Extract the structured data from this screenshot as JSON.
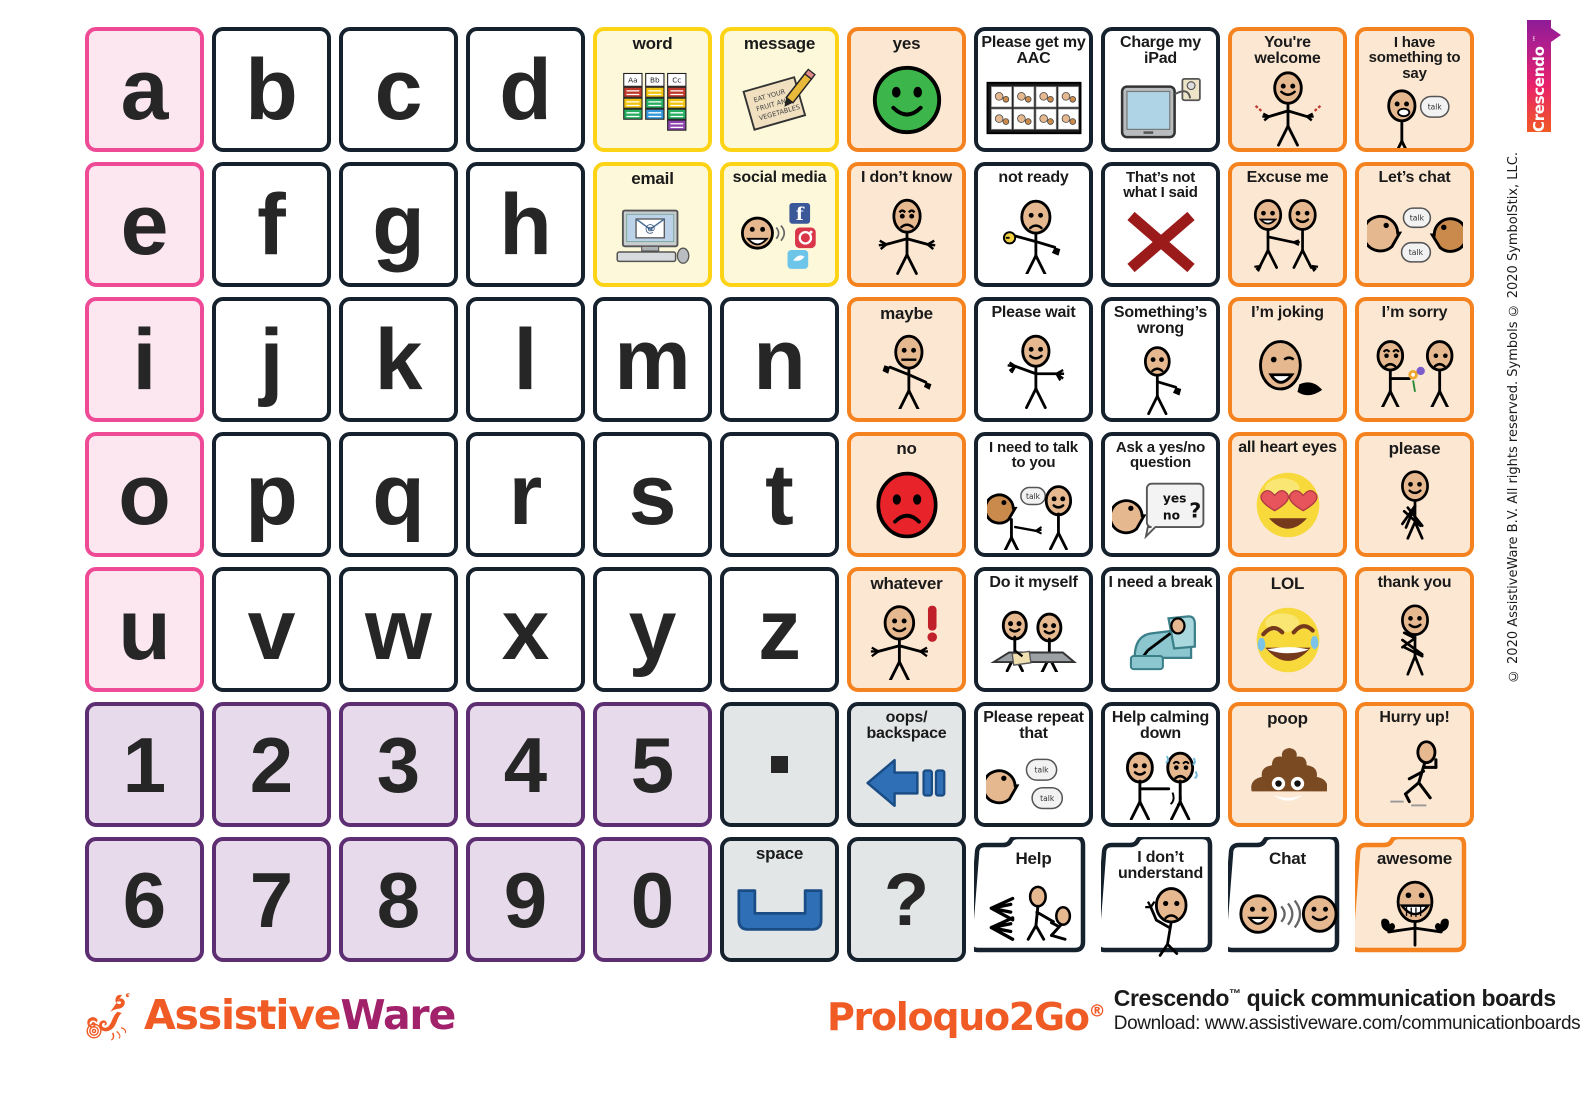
{
  "board": {
    "columns": 11,
    "rows": 7,
    "palette": {
      "vowel_fill": "#fce6f0",
      "vowel_border": "#ee4a96",
      "letter_fill": "#ffffff",
      "letter_border": "#16212e",
      "number_fill": "#e7daeb",
      "number_border": "#5d2e72",
      "key_fill": "#e3e6e6",
      "key_border": "#16212e",
      "cream_fill": "#fcf8d9",
      "cream_border": "#fdd316",
      "peach_fill": "#fce8d2",
      "peach_border": "#f4821f",
      "accent_orange": "#f05a24",
      "accent_purple": "#a2216b"
    },
    "cells": [
      {
        "r": 1,
        "c": 1,
        "kind": "vowel",
        "label": "a",
        "icon": "letter-a"
      },
      {
        "r": 1,
        "c": 2,
        "kind": "letter",
        "label": "b",
        "icon": "letter-b"
      },
      {
        "r": 1,
        "c": 3,
        "kind": "letter",
        "label": "c",
        "icon": "letter-c"
      },
      {
        "r": 1,
        "c": 4,
        "kind": "letter",
        "label": "d",
        "icon": "letter-d"
      },
      {
        "r": 1,
        "c": 5,
        "kind": "cream",
        "label": "word",
        "icon": "word-cards-icon"
      },
      {
        "r": 1,
        "c": 6,
        "kind": "cream",
        "label": "message",
        "icon": "note-and-pencil-icon"
      },
      {
        "r": 1,
        "c": 7,
        "kind": "peach",
        "label": "yes",
        "icon": "green-smiley-icon"
      },
      {
        "r": 1,
        "c": 8,
        "kind": "plain",
        "label": "Please get my AAC",
        "icon": "aac-device-grid-icon"
      },
      {
        "r": 1,
        "c": 9,
        "kind": "plain",
        "label": "Charge my iPad",
        "icon": "tablet-charging-icon"
      },
      {
        "r": 1,
        "c": 10,
        "kind": "peach",
        "label": "You're welcome",
        "icon": "person-shrug-welcome-icon"
      },
      {
        "r": 1,
        "c": 11,
        "kind": "peach",
        "label": "I have something to say",
        "icon": "person-talk-bubble-icon"
      },
      {
        "r": 2,
        "c": 1,
        "kind": "vowel",
        "label": "e",
        "icon": "letter-e"
      },
      {
        "r": 2,
        "c": 2,
        "kind": "letter",
        "label": "f",
        "icon": "letter-f"
      },
      {
        "r": 2,
        "c": 3,
        "kind": "letter",
        "label": "g",
        "icon": "letter-g"
      },
      {
        "r": 2,
        "c": 4,
        "kind": "letter",
        "label": "h",
        "icon": "letter-h"
      },
      {
        "r": 2,
        "c": 5,
        "kind": "cream",
        "label": "email",
        "icon": "computer-envelope-icon"
      },
      {
        "r": 2,
        "c": 6,
        "kind": "cream",
        "label": "social media",
        "icon": "social-media-icons"
      },
      {
        "r": 2,
        "c": 7,
        "kind": "peach",
        "label": "I don’t know",
        "icon": "person-unsure-icon"
      },
      {
        "r": 2,
        "c": 8,
        "kind": "plain",
        "label": "not ready",
        "icon": "person-thumbs-down-icon"
      },
      {
        "r": 2,
        "c": 9,
        "kind": "plain",
        "label": "That’s not what I said",
        "icon": "red-cross-icon"
      },
      {
        "r": 2,
        "c": 10,
        "kind": "peach",
        "label": "Excuse me",
        "icon": "two-people-passing-icon"
      },
      {
        "r": 2,
        "c": 11,
        "kind": "peach",
        "label": "Let’s chat",
        "icon": "two-faces-chatting-icon"
      },
      {
        "r": 3,
        "c": 1,
        "kind": "vowel",
        "label": "i",
        "icon": "letter-i"
      },
      {
        "r": 3,
        "c": 2,
        "kind": "letter",
        "label": "j",
        "icon": "letter-j"
      },
      {
        "r": 3,
        "c": 3,
        "kind": "letter",
        "label": "k",
        "icon": "letter-k"
      },
      {
        "r": 3,
        "c": 4,
        "kind": "letter",
        "label": "l",
        "icon": "letter-l"
      },
      {
        "r": 3,
        "c": 5,
        "kind": "letter",
        "label": "m",
        "icon": "letter-m"
      },
      {
        "r": 3,
        "c": 6,
        "kind": "letter",
        "label": "n",
        "icon": "letter-n"
      },
      {
        "r": 3,
        "c": 7,
        "kind": "peach",
        "label": "maybe",
        "icon": "person-hand-wobble-icon"
      },
      {
        "r": 3,
        "c": 8,
        "kind": "plain",
        "label": "Please wait",
        "icon": "person-hands-up-icon"
      },
      {
        "r": 3,
        "c": 9,
        "kind": "plain",
        "label": "Something’s wrong",
        "icon": "person-thumb-down-sad-icon"
      },
      {
        "r": 3,
        "c": 10,
        "kind": "peach",
        "label": "I’m joking",
        "icon": "person-winking-icon"
      },
      {
        "r": 3,
        "c": 11,
        "kind": "peach",
        "label": "I’m sorry",
        "icon": "person-offering-flower-icon"
      },
      {
        "r": 4,
        "c": 1,
        "kind": "vowel",
        "label": "o",
        "icon": "letter-o"
      },
      {
        "r": 4,
        "c": 2,
        "kind": "letter",
        "label": "p",
        "icon": "letter-p"
      },
      {
        "r": 4,
        "c": 3,
        "kind": "letter",
        "label": "q",
        "icon": "letter-q"
      },
      {
        "r": 4,
        "c": 4,
        "kind": "letter",
        "label": "r",
        "icon": "letter-r"
      },
      {
        "r": 4,
        "c": 5,
        "kind": "letter",
        "label": "s",
        "icon": "letter-s"
      },
      {
        "r": 4,
        "c": 6,
        "kind": "letter",
        "label": "t",
        "icon": "letter-t"
      },
      {
        "r": 4,
        "c": 7,
        "kind": "peach",
        "label": "no",
        "icon": "red-sad-face-icon"
      },
      {
        "r": 4,
        "c": 8,
        "kind": "plain",
        "label": "I need to talk to you",
        "icon": "two-people-talking-icon"
      },
      {
        "r": 4,
        "c": 9,
        "kind": "plain",
        "label": "Ask a yes/no question",
        "icon": "yes-no-question-bubble-icon"
      },
      {
        "r": 4,
        "c": 10,
        "kind": "peach",
        "label": "all heart eyes",
        "icon": "heart-eyes-emoji-icon"
      },
      {
        "r": 4,
        "c": 11,
        "kind": "peach",
        "label": "please",
        "icon": "person-please-icon"
      },
      {
        "r": 5,
        "c": 1,
        "kind": "vowel",
        "label": "u",
        "icon": "letter-u"
      },
      {
        "r": 5,
        "c": 2,
        "kind": "letter",
        "label": "v",
        "icon": "letter-v"
      },
      {
        "r": 5,
        "c": 3,
        "kind": "letter",
        "label": "w",
        "icon": "letter-w"
      },
      {
        "r": 5,
        "c": 4,
        "kind": "letter",
        "label": "x",
        "icon": "letter-x"
      },
      {
        "r": 5,
        "c": 5,
        "kind": "letter",
        "label": "y",
        "icon": "letter-y"
      },
      {
        "r": 5,
        "c": 6,
        "kind": "letter",
        "label": "z",
        "icon": "letter-z"
      },
      {
        "r": 5,
        "c": 7,
        "kind": "peach",
        "label": "whatever",
        "icon": "person-exclamation-icon"
      },
      {
        "r": 5,
        "c": 8,
        "kind": "plain",
        "label": "Do it myself",
        "icon": "person-writing-table-icon"
      },
      {
        "r": 5,
        "c": 9,
        "kind": "plain",
        "label": "I need a break",
        "icon": "person-in-recliner-icon"
      },
      {
        "r": 5,
        "c": 10,
        "kind": "peach",
        "label": "LOL",
        "icon": "laughing-tears-emoji-icon"
      },
      {
        "r": 5,
        "c": 11,
        "kind": "peach",
        "label": "thank you",
        "icon": "person-thank-you-icon"
      },
      {
        "r": 6,
        "c": 1,
        "kind": "num",
        "label": "1",
        "icon": "number-1"
      },
      {
        "r": 6,
        "c": 2,
        "kind": "num",
        "label": "2",
        "icon": "number-2"
      },
      {
        "r": 6,
        "c": 3,
        "kind": "num",
        "label": "3",
        "icon": "number-3"
      },
      {
        "r": 6,
        "c": 4,
        "kind": "num",
        "label": "4",
        "icon": "number-4"
      },
      {
        "r": 6,
        "c": 5,
        "kind": "num",
        "label": "5",
        "icon": "number-5"
      },
      {
        "r": 6,
        "c": 6,
        "kind": "key",
        "label": ".",
        "icon": "period-icon"
      },
      {
        "r": 6,
        "c": 7,
        "kind": "key",
        "label": "oops/ backspace",
        "icon": "backspace-arrow-icon"
      },
      {
        "r": 6,
        "c": 8,
        "kind": "plain",
        "label": "Please repeat that",
        "icon": "face-talk-bubbles-icon"
      },
      {
        "r": 6,
        "c": 9,
        "kind": "plain",
        "label": "Help calming down",
        "icon": "two-people-comforting-icon"
      },
      {
        "r": 6,
        "c": 10,
        "kind": "peach",
        "label": "poop",
        "icon": "poop-emoji-icon"
      },
      {
        "r": 6,
        "c": 11,
        "kind": "peach",
        "label": "Hurry up!",
        "icon": "person-running-icon"
      },
      {
        "r": 7,
        "c": 1,
        "kind": "num",
        "label": "6",
        "icon": "number-6"
      },
      {
        "r": 7,
        "c": 2,
        "kind": "num",
        "label": "7",
        "icon": "number-7"
      },
      {
        "r": 7,
        "c": 3,
        "kind": "num",
        "label": "8",
        "icon": "number-8"
      },
      {
        "r": 7,
        "c": 4,
        "kind": "num",
        "label": "9",
        "icon": "number-9"
      },
      {
        "r": 7,
        "c": 5,
        "kind": "num",
        "label": "0",
        "icon": "number-0"
      },
      {
        "r": 7,
        "c": 6,
        "kind": "key",
        "label": "space",
        "icon": "spacebar-icon"
      },
      {
        "r": 7,
        "c": 7,
        "kind": "key",
        "label": "?",
        "icon": "question-mark-icon"
      },
      {
        "r": 7,
        "c": 8,
        "kind": "folder",
        "label": "Help",
        "icon": "helping-hands-icon"
      },
      {
        "r": 7,
        "c": 9,
        "kind": "folder",
        "label": "I don’t understand",
        "icon": "person-confused-icon"
      },
      {
        "r": 7,
        "c": 10,
        "kind": "folder",
        "label": "Chat",
        "icon": "two-faces-talking-icon"
      },
      {
        "r": 7,
        "c": 11,
        "kind": "folder-peach",
        "label": "awesome",
        "icon": "person-two-thumbs-up-icon"
      }
    ]
  },
  "footer": {
    "assistiveware_part1": "Assistive",
    "assistiveware_part2": "Ware",
    "product_name": "Proloquo2Go",
    "product_reg": "®",
    "tagline_brand": "Crescendo",
    "tagline_tm": "™",
    "tagline_rest": " quick communication boards",
    "download_line": "Download: www.assistiveware.com/communicationboards"
  },
  "edge": {
    "crescendo_badge": "Crescendo",
    "crescendo_tm": "™",
    "copyright": "© 2020 AssistiveWare B.V. All rights reserved.  Symbols © 2020 SymbolStix, LLC."
  }
}
